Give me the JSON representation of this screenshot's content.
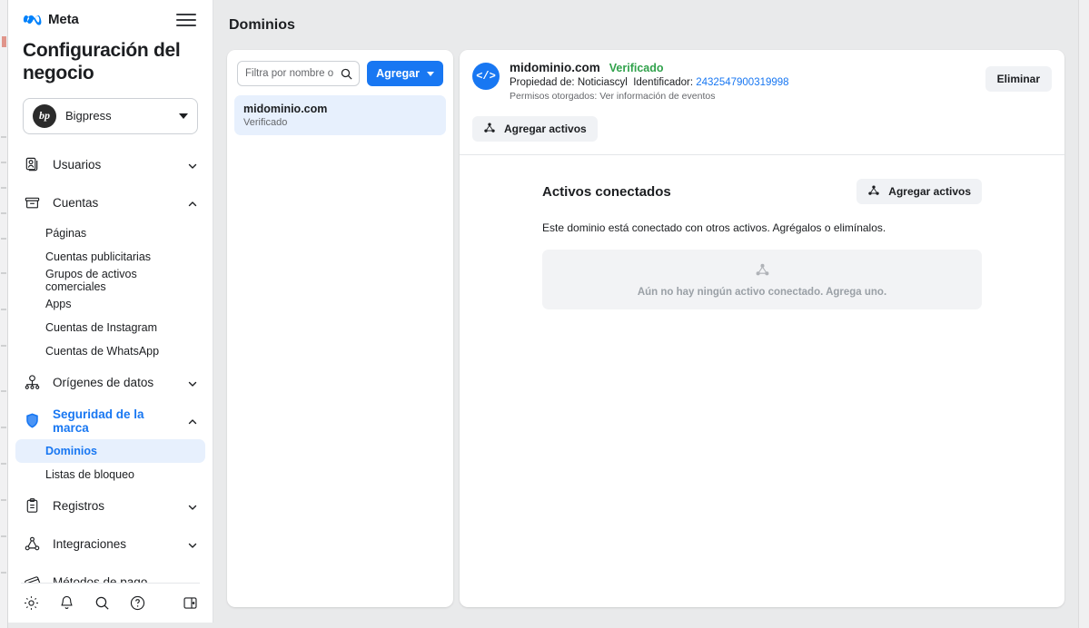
{
  "colors": {
    "brand_blue": "#1877f2",
    "verified_green": "#31a24c",
    "selected_bg": "#e7f0fd",
    "soft_button": "#f0f2f5",
    "page_bg": "#e9eaeb",
    "muted_text": "#65676b"
  },
  "sidebar": {
    "brand": "Meta",
    "brand_logo": "meta-infinity-icon",
    "menu_icon": "hamburger-icon",
    "title": "Configuración del negocio",
    "business": {
      "name": "Bigpress",
      "avatar_initials": "bp",
      "caret_icon": "chevron-down-icon"
    },
    "nav": [
      {
        "label": "Usuarios",
        "icon": "users-card-icon",
        "expanded": false,
        "chevron": "chevron-down-icon",
        "children": []
      },
      {
        "label": "Cuentas",
        "icon": "accounts-box-icon",
        "expanded": true,
        "chevron": "chevron-up-icon",
        "children": [
          {
            "label": "Páginas"
          },
          {
            "label": "Cuentas publicitarias"
          },
          {
            "label": "Grupos de activos comerciales"
          },
          {
            "label": "Apps"
          },
          {
            "label": "Cuentas de Instagram"
          },
          {
            "label": "Cuentas de WhatsApp"
          }
        ]
      },
      {
        "label": "Orígenes de datos",
        "icon": "data-sources-node-icon",
        "expanded": false,
        "chevron": "chevron-down-icon",
        "children": []
      },
      {
        "label": "Seguridad de la marca",
        "icon": "shield-icon",
        "expanded": true,
        "active": true,
        "chevron": "chevron-up-icon",
        "children": [
          {
            "label": "Dominios",
            "selected": true
          },
          {
            "label": "Listas de bloqueo"
          }
        ]
      },
      {
        "label": "Registros",
        "icon": "clipboard-icon",
        "expanded": false,
        "chevron": "chevron-down-icon",
        "children": []
      },
      {
        "label": "Integraciones",
        "icon": "integrations-node-icon",
        "expanded": false,
        "chevron": "chevron-down-icon",
        "children": []
      },
      {
        "label": "Métodos de pago",
        "icon": "credit-card-icon",
        "expanded": false,
        "chevron": "",
        "children": []
      }
    ],
    "footer_icons": [
      {
        "name": "gear-icon"
      },
      {
        "name": "bell-icon"
      },
      {
        "name": "search-icon"
      },
      {
        "name": "help-circle-icon"
      },
      {
        "name": "collapse-panel-icon"
      }
    ]
  },
  "header": {
    "title": "Dominios"
  },
  "list_panel": {
    "search": {
      "placeholder": "Filtra por nombre o id...",
      "value": "",
      "icon": "search-icon"
    },
    "add_button": {
      "label": "Agregar",
      "caret_icon": "chevron-down-icon"
    },
    "domains": [
      {
        "name": "midominio.com",
        "status": "Verificado",
        "selected": true
      }
    ]
  },
  "detail": {
    "badge_icon": "code-tags-icon",
    "badge_text": "</>",
    "domain": "midominio.com",
    "status": "Verificado",
    "owner_label": "Propiedad de:",
    "owner_value": "Noticiascyl",
    "identifier_label": "Identificador:",
    "identifier_value": "2432547900319998",
    "permissions": "Permisos otorgados: Ver información de eventos",
    "delete_button": "Eliminar",
    "add_assets_button": {
      "label": "Agregar activos",
      "icon": "assets-node-icon"
    },
    "connected": {
      "title": "Activos conectados",
      "add_button": {
        "label": "Agregar activos",
        "icon": "assets-node-icon"
      },
      "description": "Este dominio está conectado con otros activos. Agrégalos o elimínalos.",
      "empty_icon": "assets-node-icon",
      "empty_text": "Aún no hay ningún activo conectado. Agrega uno."
    }
  }
}
